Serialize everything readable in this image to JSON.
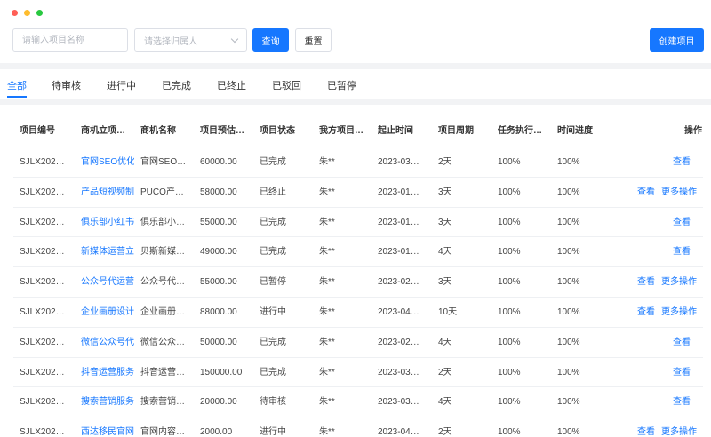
{
  "search": {
    "name_placeholder": "请输入项目名称",
    "owner_placeholder": "请选择归属人",
    "query_label": "查询",
    "reset_label": "重置",
    "create_label": "创建项目"
  },
  "tabs": [
    "全部",
    "待审核",
    "进行中",
    "已完成",
    "已终止",
    "已驳回",
    "已暂停"
  ],
  "columns": [
    "项目编号",
    "商机立项…",
    "商机名称",
    "项目预估…",
    "项目状态",
    "我方项目…",
    "起止时间",
    "项目周期",
    "任务执行…",
    "时间进度",
    "操作"
  ],
  "ops": {
    "view": "查看",
    "more": "更多操作"
  },
  "rows": [
    {
      "id": "SJLX202…",
      "project": "官网SEO优化",
      "opportunity": "官网SEO…",
      "amount": "60000.00",
      "status": "已完成",
      "owner": "朱**",
      "period": "2023-03…",
      "duration": "2天",
      "task": "100%",
      "progress": "100%",
      "more": false
    },
    {
      "id": "SJLX202…",
      "project": "产品短视频制",
      "opportunity": "PUCO产…",
      "amount": "58000.00",
      "status": "已终止",
      "owner": "朱**",
      "period": "2023-01…",
      "duration": "3天",
      "task": "100%",
      "progress": "100%",
      "more": true
    },
    {
      "id": "SJLX202…",
      "project": "俱乐部小红书",
      "opportunity": "俱乐部小…",
      "amount": "55000.00",
      "status": "已完成",
      "owner": "朱**",
      "period": "2023-01…",
      "duration": "3天",
      "task": "100%",
      "progress": "100%",
      "more": false
    },
    {
      "id": "SJLX202…",
      "project": "新媒体运营立",
      "opportunity": "贝斯新媒…",
      "amount": "49000.00",
      "status": "已完成",
      "owner": "朱**",
      "period": "2023-01…",
      "duration": "4天",
      "task": "100%",
      "progress": "100%",
      "more": false
    },
    {
      "id": "SJLX202…",
      "project": "公众号代运营",
      "opportunity": "公众号代…",
      "amount": "55000.00",
      "status": "已暂停",
      "owner": "朱**",
      "period": "2023-02…",
      "duration": "3天",
      "task": "100%",
      "progress": "100%",
      "more": true
    },
    {
      "id": "SJLX202…",
      "project": "企业画册设计",
      "opportunity": "企业画册…",
      "amount": "88000.00",
      "status": "进行中",
      "owner": "朱**",
      "period": "2023-04…",
      "duration": "10天",
      "task": "100%",
      "progress": "100%",
      "more": true
    },
    {
      "id": "SJLX202…",
      "project": "微信公众号代",
      "opportunity": "微信公众…",
      "amount": "50000.00",
      "status": "已完成",
      "owner": "朱**",
      "period": "2023-02…",
      "duration": "4天",
      "task": "100%",
      "progress": "100%",
      "more": false
    },
    {
      "id": "SJLX202…",
      "project": "抖音运营服务",
      "opportunity": "抖音运营…",
      "amount": "150000.00",
      "status": "已完成",
      "owner": "朱**",
      "period": "2023-03…",
      "duration": "2天",
      "task": "100%",
      "progress": "100%",
      "more": false
    },
    {
      "id": "SJLX202…",
      "project": "搜索营销服务",
      "opportunity": "搜索营销…",
      "amount": "20000.00",
      "status": "待审核",
      "owner": "朱**",
      "period": "2023-03…",
      "duration": "4天",
      "task": "100%",
      "progress": "100%",
      "more": false
    },
    {
      "id": "SJLX202…",
      "project": "西达移民官网",
      "opportunity": "官网内容…",
      "amount": "2000.00",
      "status": "进行中",
      "owner": "朱**",
      "period": "2023-04…",
      "duration": "2天",
      "task": "100%",
      "progress": "100%",
      "more": true
    }
  ]
}
